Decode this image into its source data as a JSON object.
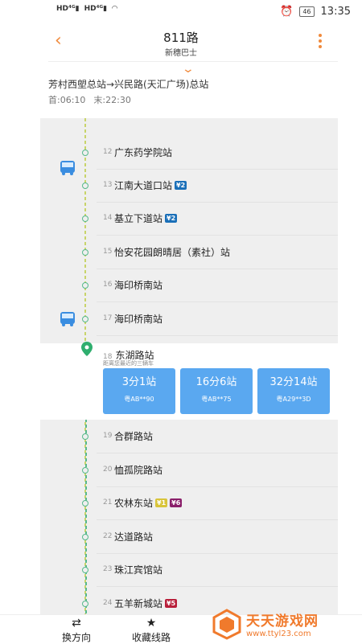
{
  "status_bar": {
    "left_indicators": [
      "HD 4G",
      "HD 4G",
      "wifi"
    ],
    "battery": "46",
    "time": "13:35"
  },
  "header": {
    "title": "811路",
    "subtitle": "新穗巴士"
  },
  "route": {
    "direction": "芳村西塱总站→兴民路(天汇广场)总站",
    "first_bus": "首:06:10",
    "last_bus": "末:22:30"
  },
  "colors": {
    "accent": "#f08a3c",
    "card_blue": "#5aa8f0",
    "line_green": "#55b98b",
    "metro_blue": "#1a6fb8",
    "metro_yellow": "#d8c43a",
    "metro_purple": "#8a1f6a",
    "metro_red": "#b81f3a"
  },
  "stops_before": [
    {
      "num": "12",
      "name": "广东药学院站",
      "badges": []
    },
    {
      "num": "13",
      "name": "江南大道口站",
      "badges": [
        {
          "text": "¥2",
          "color": "#1a6fb8"
        }
      ]
    },
    {
      "num": "14",
      "name": "基立下道站",
      "badges": [
        {
          "text": "¥2",
          "color": "#1a6fb8"
        }
      ]
    },
    {
      "num": "15",
      "name": "怡安花园朗晴居（素社）站",
      "badges": []
    },
    {
      "num": "16",
      "name": "海印桥南站",
      "badges": []
    },
    {
      "num": "17",
      "name": "海印桥南站",
      "badges": []
    }
  ],
  "current_stop": {
    "num": "18",
    "name": "东湖路站",
    "note": "距离您最近的三辆车",
    "arrivals": [
      {
        "time": "3分1站",
        "plate": "粤AB**90"
      },
      {
        "time": "16分6站",
        "plate": "粤AB**75"
      },
      {
        "time": "32分14站",
        "plate": "粤A29**3D"
      }
    ]
  },
  "stops_after": [
    {
      "num": "19",
      "name": "合群路站",
      "badges": []
    },
    {
      "num": "20",
      "name": "恤孤院路站",
      "badges": []
    },
    {
      "num": "21",
      "name": "农林东站",
      "badges": [
        {
          "text": "¥1",
          "color": "#d8c43a"
        },
        {
          "text": "¥6",
          "color": "#8a1f6a"
        }
      ]
    },
    {
      "num": "22",
      "name": "达道路站",
      "badges": []
    },
    {
      "num": "23",
      "name": "珠江宾馆站",
      "badges": []
    },
    {
      "num": "24",
      "name": "五羊新城站",
      "badges": [
        {
          "text": "¥5",
          "color": "#b81f3a"
        }
      ]
    }
  ],
  "bottom_bar": {
    "switch_direction": "换方向",
    "favorite_route": "收藏线路"
  },
  "watermark": {
    "title": "天天游戏网",
    "url": "www.ttyl23.com"
  }
}
